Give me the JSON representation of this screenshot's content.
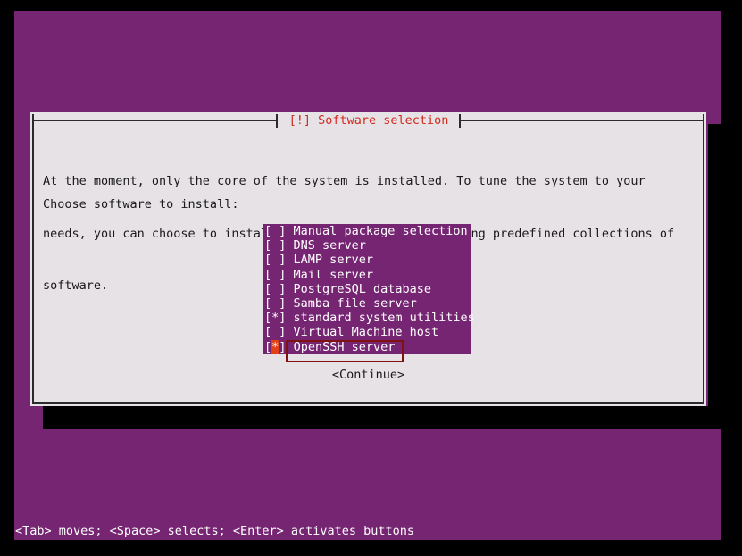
{
  "screen": {
    "background_color": "#000000",
    "canvas_color": "#762572",
    "accent_red": "#d02b20",
    "highlight_orange": "#e24016",
    "dialog_background": "#e6e2e5",
    "cursor_box_color": "#7f1111"
  },
  "dialog": {
    "title": "[!] Software selection",
    "paragraph": [
      "At the moment, only the core of the system is installed. To tune the system to your",
      "needs, you can choose to install one or more of the following predefined collections of",
      "software."
    ],
    "prompt": "Choose software to install:",
    "continue_label": "<Continue>"
  },
  "software_list": {
    "items": [
      {
        "mark": " ",
        "checked": false,
        "selected": false,
        "label": "Manual package selection"
      },
      {
        "mark": " ",
        "checked": false,
        "selected": false,
        "label": "DNS server"
      },
      {
        "mark": " ",
        "checked": false,
        "selected": false,
        "label": "LAMP server"
      },
      {
        "mark": " ",
        "checked": false,
        "selected": false,
        "label": "Mail server"
      },
      {
        "mark": " ",
        "checked": false,
        "selected": false,
        "label": "PostgreSQL database"
      },
      {
        "mark": " ",
        "checked": false,
        "selected": false,
        "label": "Samba file server"
      },
      {
        "mark": "*",
        "checked": true,
        "selected": false,
        "label": "standard system utilities"
      },
      {
        "mark": " ",
        "checked": false,
        "selected": false,
        "label": "Virtual Machine host"
      },
      {
        "mark": "*",
        "checked": true,
        "selected": true,
        "label": "OpenSSH server"
      }
    ]
  },
  "status_bar": {
    "text": "<Tab> moves; <Space> selects; <Enter> activates buttons"
  }
}
